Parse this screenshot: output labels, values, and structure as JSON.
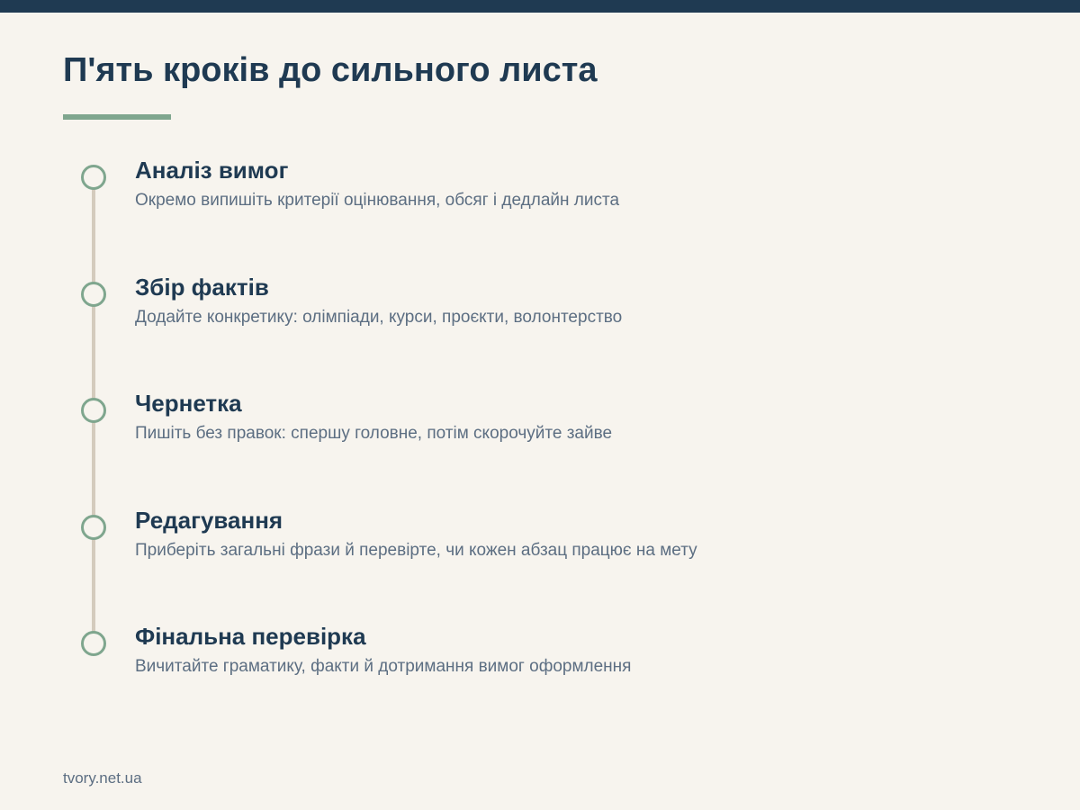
{
  "header": {
    "title": "П'ять кроків до сильного листа"
  },
  "steps": [
    {
      "title": "Аналіз вимог",
      "description": "Окремо випишіть критерії оцінювання, обсяг і дедлайн листа"
    },
    {
      "title": "Збір фактів",
      "description": "Додайте конкретику: олімпіади, курси, проєкти, волонтерство"
    },
    {
      "title": "Чернетка",
      "description": "Пишіть без правок: спершу головне, потім скорочуйте зайве"
    },
    {
      "title": "Редагування",
      "description": "Приберіть загальні фрази й перевірте, чи кожен абзац працює на мету"
    },
    {
      "title": "Фінальна перевірка",
      "description": "Вичитайте граматику, факти й дотримання вимог оформлення"
    }
  ],
  "footer": {
    "site": "tvory.net.ua"
  },
  "colors": {
    "background": "#f7f4ee",
    "primary": "#1f3a52",
    "accent": "#7fa68e",
    "timeline": "#d4cbbd",
    "muted_text": "#5c6e82"
  },
  "icons": {
    "step_marker": "circle-outline-icon"
  }
}
